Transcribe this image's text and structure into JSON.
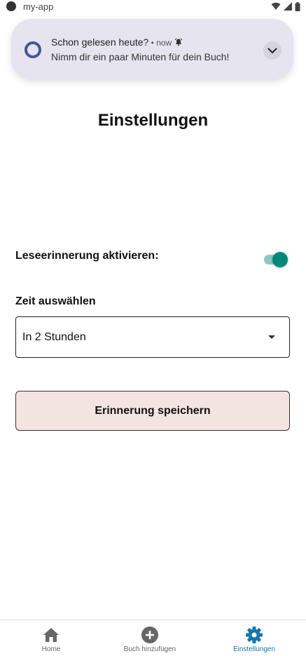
{
  "status_bar": {
    "app_name": "my-app"
  },
  "notification": {
    "title": "Schon gelesen heute?",
    "meta": " • now ",
    "body": "Nimm dir ein paar Minuten für dein Buch!"
  },
  "page": {
    "title": "Einstellungen"
  },
  "settings": {
    "reminder_label": "Leseerinnerung aktivieren:",
    "reminder_enabled": true,
    "time_label": "Zeit auswählen",
    "time_selected": "In 2 Stunden",
    "save_label": "Erinnerung speichern"
  },
  "bottom_nav": {
    "items": [
      {
        "label": "Home",
        "icon": "home-icon",
        "active": false
      },
      {
        "label": "Buch hinzufügen",
        "icon": "add-circle-icon",
        "active": false
      },
      {
        "label": "Einstellungen",
        "icon": "gear-icon",
        "active": true
      }
    ]
  },
  "colors": {
    "accent": "#00897b",
    "nav_active": "#1676a8",
    "button_bg": "#f3e3e1",
    "notification_bg": "#e6e4ee"
  }
}
